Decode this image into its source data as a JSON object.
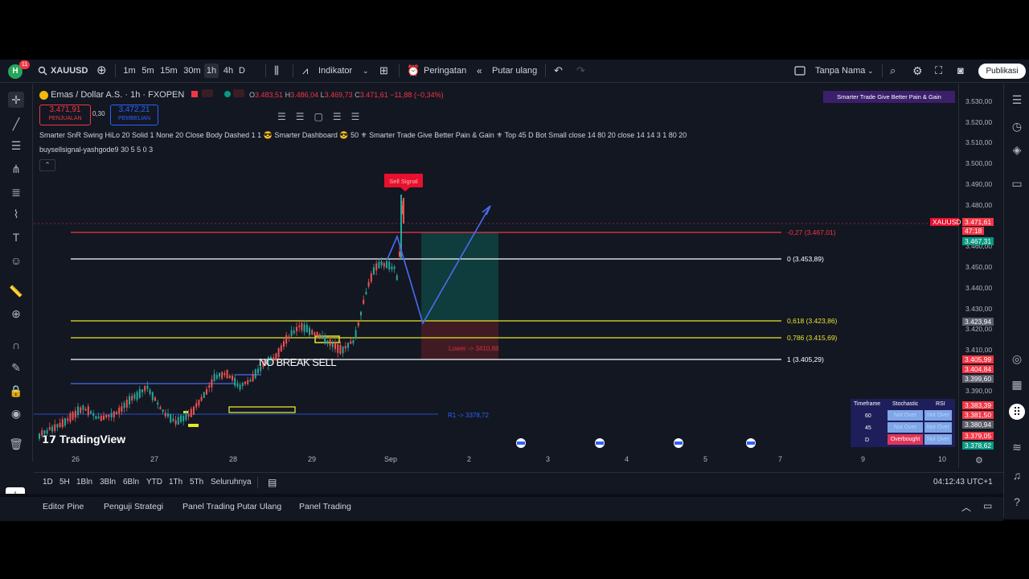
{
  "topbar": {
    "avatar_letter": "H",
    "avatar_badge": "11",
    "symbol": "XAUUSD",
    "intervals": [
      "1m",
      "5m",
      "15m",
      "30m",
      "1h",
      "4h",
      "D"
    ],
    "active_interval": "1h",
    "indicators_label": "Indikator",
    "alerts_label": "Peringatan",
    "replay_label": "Putar ulang",
    "layout_name": "Tanpa Nama",
    "publish_label": "Publikasi"
  },
  "legend": {
    "title": "Emas / Dollar A.S. · 1h · FXOPEN",
    "ohlc": {
      "o": "3.483,51",
      "h": "3.486,04",
      "l": "3.469,73",
      "c": "3.471,61",
      "change": "−11,88 (−0,34%)"
    },
    "sell_price": "3.471,91",
    "sell_label": "PENJUALAN",
    "spread": "0,30",
    "buy_price": "3.472,21",
    "buy_label": "PEMBELIAN",
    "indicator_line1": "Smarter SnR Swing HiLo 20 Solid 1 None 20 Close Body Dashed 1 1 😎 Smarter Dashboard 😎 50 ⚜ Smarter Trade Give Better Pain & Gain ⚜ Top 45 D Bot Small close 14 80 20 close 14 14 3 1 80 20",
    "indicator_line2": "buysellsignal-yashgode9 30 5 5 0 3",
    "banner": "Smarter Trade Give Better Pain & Gain"
  },
  "chart_data": {
    "type": "candlestick",
    "symbol": "XAUUSD",
    "x_ticks": [
      "26",
      "27",
      "28",
      "29",
      "Sep",
      "2",
      "3",
      "4",
      "5",
      "7",
      "9",
      "10"
    ],
    "y_ticks": [
      "3.530,00",
      "3.520,00",
      "3.510,00",
      "3.500,00",
      "3.490,00",
      "3.480,00",
      "3.460,00",
      "3.450,00",
      "3.440,00",
      "3.430,00",
      "3.420,00",
      "3.410,00",
      "3.390,00"
    ],
    "fib_levels": [
      {
        "label": "-0,27 (3.467,01)",
        "color": "#f23645"
      },
      {
        "label": "0 (3.453,89)",
        "color": "#ffffff"
      },
      {
        "label": "0,618 (3.423,86)",
        "color": "#e5e52b"
      },
      {
        "label": "0,786 (3.415,69)",
        "color": "#e5e52b"
      },
      {
        "label": "1 (3.405,29)",
        "color": "#ffffff"
      }
    ],
    "annotations": {
      "no_break_sell": "NO BREAK SELL",
      "sell_signal": "Sell Signal",
      "lower": "Lower -> 3410,88",
      "r1": "R1 -> 3378,72"
    }
  },
  "price_scale": {
    "last_symbol": "XAUUSD",
    "last_price": "3.471,61",
    "countdown": "47:18",
    "tag_green": "3.467,31",
    "tag_gray_1": "3.423,94",
    "tags_red": [
      "3.405,99",
      "3.404,84"
    ],
    "tag_gray_2": "3.399,60",
    "tags_red_2": [
      "3.383,39",
      "3.381,50"
    ],
    "tag_gray_3": "3.380,94",
    "tag_red_3": "3.379,05",
    "tag_green_2": "3.378,62"
  },
  "dashboard_table": {
    "headers": [
      "Timeframe",
      "Stochastic",
      "RSI"
    ],
    "rows": [
      {
        "tf": "60",
        "stoch": "Not Over",
        "rsi": "Not Over"
      },
      {
        "tf": "45",
        "stoch": "Not Over",
        "rsi": "Not Over"
      },
      {
        "tf": "D",
        "stoch": "Overbought",
        "rsi": "Not Over"
      }
    ]
  },
  "bottombar": {
    "ranges": [
      "1D",
      "5H",
      "1Bln",
      "3Bln",
      "6Bln",
      "YTD",
      "1Th",
      "5Th",
      "Seluruhnya"
    ],
    "clock": "04:12:43 UTC+1"
  },
  "panels": [
    "Editor Pine",
    "Penguji Strategi",
    "Panel Trading Putar Ulang",
    "Panel Trading"
  ],
  "watermark": "TradingView",
  "colors": {
    "bg": "#131722",
    "up": "#26a69a",
    "down": "#ef5350",
    "accent": "#2962ff"
  }
}
